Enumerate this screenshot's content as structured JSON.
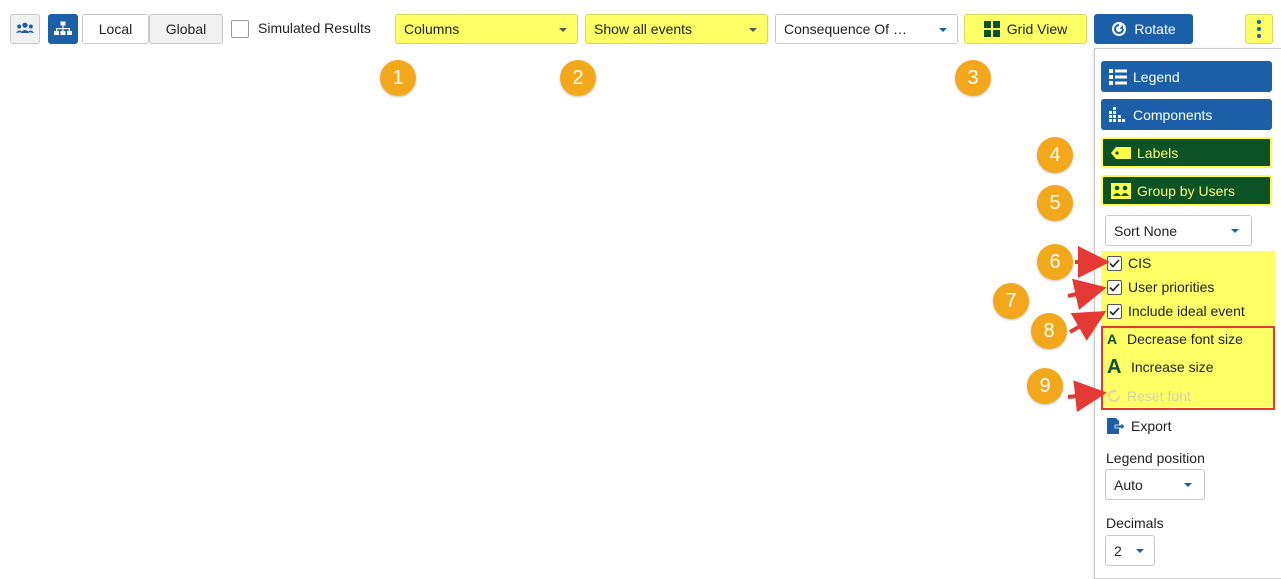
{
  "toolbar": {
    "users_icon": "users-icon",
    "hierarchy_icon": "hierarchy-icon",
    "local_label": "Local",
    "global_label": "Global",
    "simulated_results_label": "Simulated Results",
    "columns_select_value": "Columns",
    "events_select_value": "Show all events",
    "consequence_select_value": "Consequence Of …",
    "grid_view_label": "Grid View",
    "rotate_label": "Rotate",
    "more_icon": "kebab-menu-icon"
  },
  "markers": [
    "1",
    "2",
    "3",
    "4",
    "5",
    "6",
    "7",
    "8",
    "9"
  ],
  "panel": {
    "legend_label": "Legend",
    "components_label": "Components",
    "labels_label": "Labels",
    "group_by_users_label": "Group by Users",
    "sort_value": "Sort None",
    "checks": [
      {
        "label": "CIS",
        "checked": true
      },
      {
        "label": "User priorities",
        "checked": true
      },
      {
        "label": "Include ideal event",
        "checked": true
      }
    ],
    "decrease_font_label": "Decrease font size",
    "increase_size_label": "Increase size",
    "reset_font_label": "Reset font",
    "export_label": "Export",
    "legend_position_label": "Legend position",
    "legend_position_value": "Auto",
    "decimals_label": "Decimals",
    "decimals_value": "2"
  },
  "colors": {
    "brand_blue": "#1a5fa8",
    "dark_green": "#0b5226",
    "highlight_yellow": "#ffff66",
    "marker_orange": "#f3a81c",
    "arrow_red": "#e53935"
  }
}
